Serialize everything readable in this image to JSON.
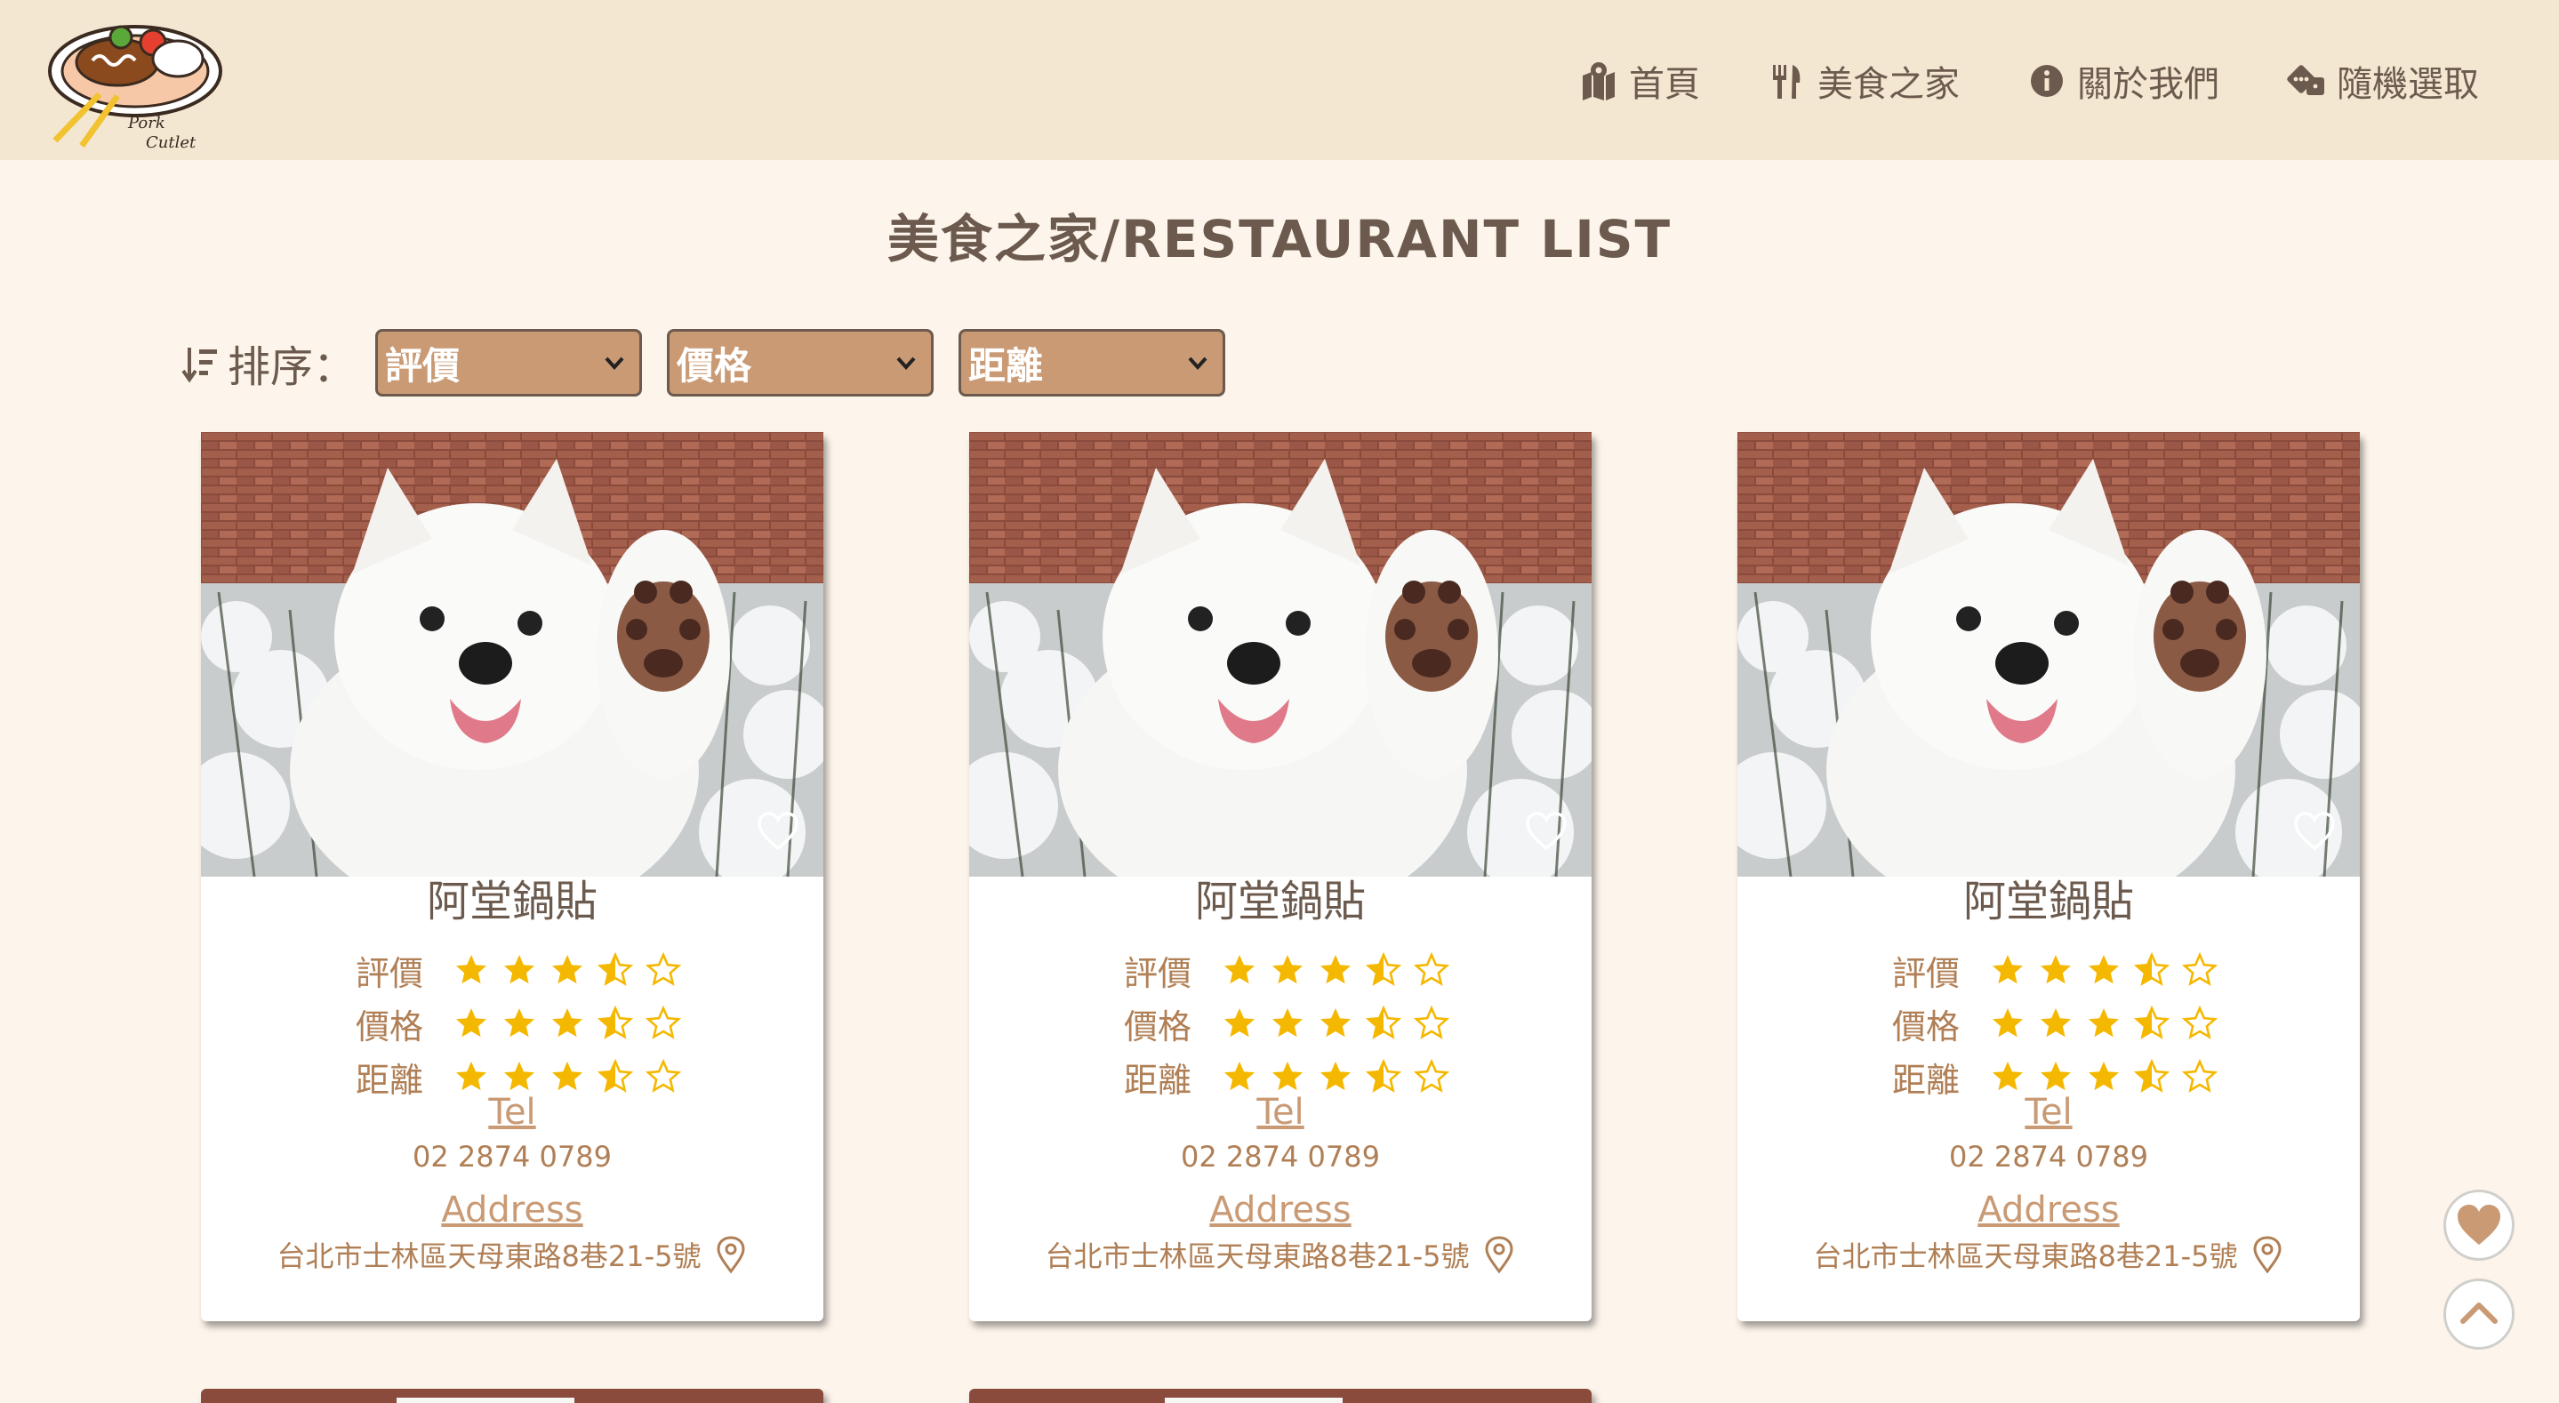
{
  "header": {
    "logo_text_line1": "Pork",
    "logo_text_line2": "Cutlet",
    "nav": [
      {
        "label": "首頁",
        "icon": "map-marked-icon"
      },
      {
        "label": "美食之家",
        "icon": "utensils-icon"
      },
      {
        "label": "關於我們",
        "icon": "info-circle-icon"
      },
      {
        "label": "隨機選取",
        "icon": "dice-icon"
      }
    ]
  },
  "page": {
    "title": "美食之家/RESTAURANT LIST"
  },
  "sort": {
    "label": "排序：",
    "selects": [
      "評價",
      "價格",
      "距離"
    ]
  },
  "cards": [
    {
      "name": "阿堂鍋貼",
      "ratings": [
        {
          "label": "評價",
          "stars": 3.5
        },
        {
          "label": "價格",
          "stars": 3.5
        },
        {
          "label": "距離",
          "stars": 3.5
        }
      ],
      "tel_label": "Tel",
      "tel": "02 2874 0789",
      "address_label": "Address",
      "address": "台北市士林區天母東路8巷21-5號"
    },
    {
      "name": "阿堂鍋貼",
      "ratings": [
        {
          "label": "評價",
          "stars": 3.5
        },
        {
          "label": "價格",
          "stars": 3.5
        },
        {
          "label": "距離",
          "stars": 3.5
        }
      ],
      "tel_label": "Tel",
      "tel": "02 2874 0789",
      "address_label": "Address",
      "address": "台北市士林區天母東路8巷21-5號"
    },
    {
      "name": "阿堂鍋貼",
      "ratings": [
        {
          "label": "評價",
          "stars": 3.5
        },
        {
          "label": "價格",
          "stars": 3.5
        },
        {
          "label": "距離",
          "stars": 3.5
        }
      ],
      "tel_label": "Tel",
      "tel": "02 2874 0789",
      "address_label": "Address",
      "address": "台北市士林區天母東路8巷21-5號"
    }
  ],
  "colors": {
    "header_bg": "#f3e7d1",
    "page_bg": "#fdf5eb",
    "accent": "#c99a74",
    "text": "#6b5a4d",
    "star": "#f5b800"
  }
}
